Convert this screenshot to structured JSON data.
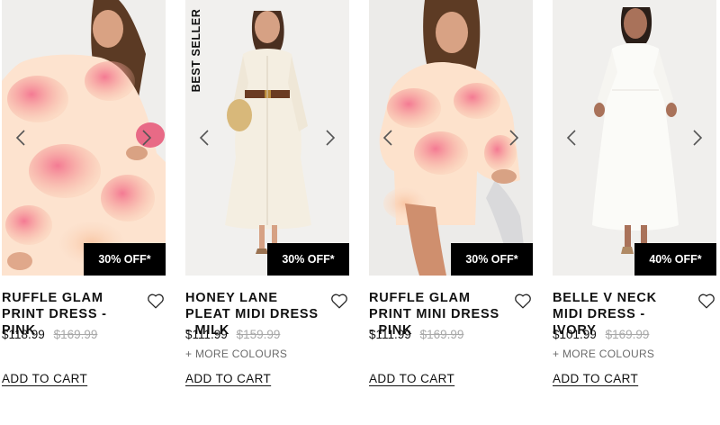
{
  "icons": {
    "prev": "chevron-left-icon",
    "next": "chevron-right-icon",
    "wishlist": "heart-outline-icon"
  },
  "colors": {
    "badge_bg": "#000000",
    "badge_text": "#ffffff",
    "was_price": "#a8a8a8"
  },
  "products": [
    {
      "name": "RUFFLE GLAM PRINT DRESS - PINK",
      "price": "$118.99",
      "was_price": "$169.99",
      "discount": "30% OFF*",
      "badge": "",
      "more_colours": "",
      "add_to_cart": "ADD TO CART"
    },
    {
      "name": "HONEY LANE PLEAT MIDI DRESS - MILK",
      "price": "$111.99",
      "was_price": "$159.99",
      "discount": "30% OFF*",
      "badge": "BEST SELLER",
      "more_colours": "+ MORE COLOURS",
      "add_to_cart": "ADD TO CART"
    },
    {
      "name": "RUFFLE GLAM PRINT MINI DRESS - PINK",
      "price": "$111.99",
      "was_price": "$169.99",
      "discount": "30% OFF*",
      "badge": "",
      "more_colours": "",
      "add_to_cart": "ADD TO CART"
    },
    {
      "name": "BELLE V NECK MIDI DRESS - IVORY",
      "price": "$101.99",
      "was_price": "$169.99",
      "discount": "40% OFF*",
      "badge": "",
      "more_colours": "+ MORE COLOURS",
      "add_to_cart": "ADD TO CART"
    }
  ]
}
